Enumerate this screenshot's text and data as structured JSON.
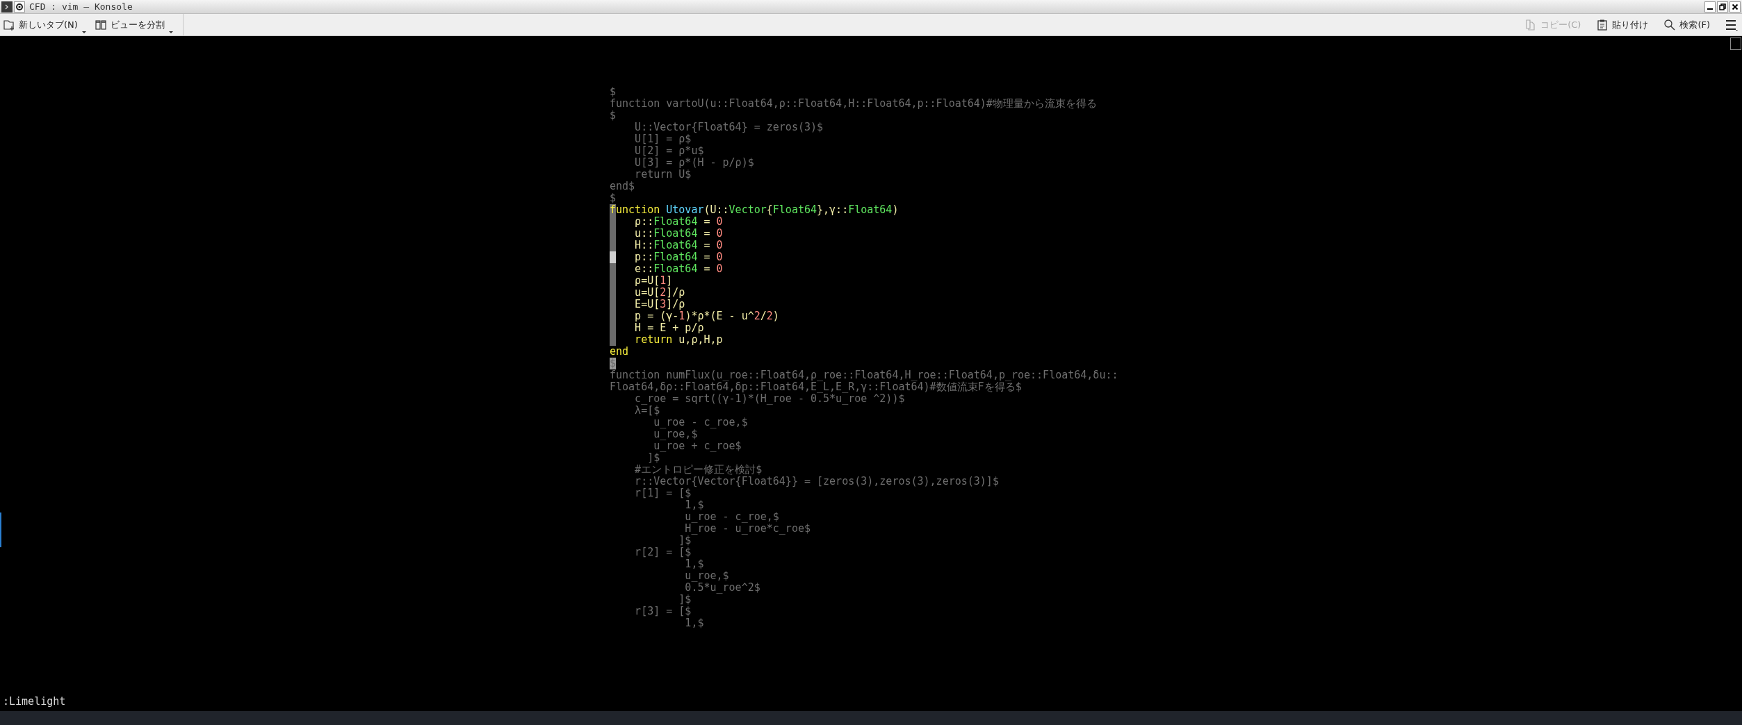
{
  "window": {
    "title": "CFD : vim — Konsole"
  },
  "toolbar": {
    "left": [
      {
        "label": "新しいタブ(N)",
        "dropdown": true
      },
      {
        "label": "ビューを分割",
        "dropdown": true
      }
    ],
    "right": [
      {
        "label": "コピー(C)",
        "disabled": true
      },
      {
        "label": "貼り付け",
        "disabled": false
      },
      {
        "label": "検索(F)",
        "disabled": false
      }
    ]
  },
  "editor": {
    "lines": [
      {
        "segments": [
          {
            "text": "$",
            "kind": "dim"
          }
        ]
      },
      {
        "segments": [
          {
            "text": "function vartoU(u::Float64,ρ::Float64,H::Float64,p::Float64)#物理量から流束を得る",
            "kind": "dim"
          }
        ]
      },
      {
        "segments": [
          {
            "text": "$",
            "kind": "dim"
          }
        ]
      },
      {
        "segments": [
          {
            "text": "    U::Vector{Float64} = zeros(3)$",
            "kind": "dim"
          }
        ]
      },
      {
        "segments": [
          {
            "text": "    U[1] = ρ$",
            "kind": "dim"
          }
        ]
      },
      {
        "segments": [
          {
            "text": "    U[2] = ρ*u$",
            "kind": "dim"
          }
        ]
      },
      {
        "segments": [
          {
            "text": "    U[3] = ρ*(H - p/ρ)$",
            "kind": "dim"
          }
        ]
      },
      {
        "segments": [
          {
            "text": "    return U$",
            "kind": "dim"
          }
        ]
      },
      {
        "segments": [
          {
            "text": "end$",
            "kind": "dim"
          }
        ]
      },
      {
        "segments": [
          {
            "text": "$",
            "kind": "dim"
          }
        ]
      },
      {
        "guide": true,
        "segments": [
          {
            "text": "function",
            "kind": "keyword"
          },
          {
            "text": " Utovar",
            "kind": "function"
          },
          {
            "text": "(U::",
            "kind": "text"
          },
          {
            "text": "Vector",
            "kind": "type"
          },
          {
            "text": "{",
            "kind": "text"
          },
          {
            "text": "Float64",
            "kind": "type"
          },
          {
            "text": "},γ::",
            "kind": "text"
          },
          {
            "text": "Float64",
            "kind": "type"
          },
          {
            "text": ")",
            "kind": "text"
          }
        ]
      },
      {
        "guide": true,
        "segments": [
          {
            "text": "    ρ::",
            "kind": "text"
          },
          {
            "text": "Float64",
            "kind": "type"
          },
          {
            "text": " = ",
            "kind": "text"
          },
          {
            "text": "0",
            "kind": "number"
          }
        ]
      },
      {
        "guide": true,
        "segments": [
          {
            "text": "    u::",
            "kind": "text"
          },
          {
            "text": "Float64",
            "kind": "type"
          },
          {
            "text": " = ",
            "kind": "text"
          },
          {
            "text": "0",
            "kind": "number"
          }
        ]
      },
      {
        "guide": true,
        "segments": [
          {
            "text": "    H::",
            "kind": "text"
          },
          {
            "text": "Float64",
            "kind": "type"
          },
          {
            "text": " = ",
            "kind": "text"
          },
          {
            "text": "0",
            "kind": "number"
          }
        ]
      },
      {
        "guide": true,
        "bright": true,
        "segments": [
          {
            "text": "    p::",
            "kind": "text"
          },
          {
            "text": "Float64",
            "kind": "type"
          },
          {
            "text": " = ",
            "kind": "text"
          },
          {
            "text": "0",
            "kind": "number"
          }
        ]
      },
      {
        "guide": true,
        "segments": [
          {
            "text": "    e::",
            "kind": "text"
          },
          {
            "text": "Float64",
            "kind": "type"
          },
          {
            "text": " = ",
            "kind": "text"
          },
          {
            "text": "0",
            "kind": "number"
          }
        ]
      },
      {
        "guide": true,
        "segments": [
          {
            "text": "    ρ=U[",
            "kind": "text"
          },
          {
            "text": "1",
            "kind": "number"
          },
          {
            "text": "]",
            "kind": "text"
          }
        ]
      },
      {
        "guide": true,
        "segments": [
          {
            "text": "    u=U[",
            "kind": "text"
          },
          {
            "text": "2",
            "kind": "number"
          },
          {
            "text": "]/ρ",
            "kind": "text"
          }
        ]
      },
      {
        "guide": true,
        "segments": [
          {
            "text": "    E=U[",
            "kind": "text"
          },
          {
            "text": "3",
            "kind": "number"
          },
          {
            "text": "]/ρ",
            "kind": "text"
          }
        ]
      },
      {
        "guide": true,
        "segments": [
          {
            "text": "    p = (γ-",
            "kind": "text"
          },
          {
            "text": "1",
            "kind": "number"
          },
          {
            "text": ")*ρ*(E - u^",
            "kind": "text"
          },
          {
            "text": "2",
            "kind": "number"
          },
          {
            "text": "/",
            "kind": "text"
          },
          {
            "text": "2",
            "kind": "number"
          },
          {
            "text": ")",
            "kind": "text"
          }
        ]
      },
      {
        "guide": true,
        "segments": [
          {
            "text": "    H = E + p/ρ",
            "kind": "text"
          }
        ]
      },
      {
        "guide": true,
        "segments": [
          {
            "text": "    return",
            "kind": "keyword"
          },
          {
            "text": " u,ρ,H,p",
            "kind": "text"
          }
        ]
      },
      {
        "segments": [
          {
            "text": "end",
            "kind": "keyword"
          }
        ]
      },
      {
        "cursor": true,
        "segments": [
          {
            "text": "$",
            "kind": "dim"
          }
        ]
      },
      {
        "segments": [
          {
            "text": "function numFlux(u_roe::Float64,ρ_roe::Float64,H_roe::Float64,p_roe::Float64,δu::",
            "kind": "dim"
          }
        ]
      },
      {
        "segments": [
          {
            "text": "Float64,δρ::Float64,δp::Float64,E_L,E_R,γ::Float64)#数値流束Fを得る$",
            "kind": "dim"
          }
        ]
      },
      {
        "segments": [
          {
            "text": "    c_roe = sqrt((γ-1)*(H_roe - 0.5*u_roe ^2))$",
            "kind": "dim"
          }
        ]
      },
      {
        "segments": [
          {
            "text": "    λ=[$",
            "kind": "dim"
          }
        ]
      },
      {
        "segments": [
          {
            "text": "       u_roe - c_roe,$",
            "kind": "dim"
          }
        ]
      },
      {
        "segments": [
          {
            "text": "       u_roe,$",
            "kind": "dim"
          }
        ]
      },
      {
        "segments": [
          {
            "text": "       u_roe + c_roe$",
            "kind": "dim"
          }
        ]
      },
      {
        "segments": [
          {
            "text": "      ]$",
            "kind": "dim"
          }
        ]
      },
      {
        "segments": [
          {
            "text": "    #エントロピー修正を検討$",
            "kind": "dim"
          }
        ]
      },
      {
        "segments": [
          {
            "text": "    r::Vector{Vector{Float64}} = [zeros(3),zeros(3),zeros(3)]$",
            "kind": "dim"
          }
        ]
      },
      {
        "segments": [
          {
            "text": "    r[1] = [$",
            "kind": "dim"
          }
        ]
      },
      {
        "segments": [
          {
            "text": "            1,$",
            "kind": "dim"
          }
        ]
      },
      {
        "segments": [
          {
            "text": "            u_roe - c_roe,$",
            "kind": "dim"
          }
        ]
      },
      {
        "segments": [
          {
            "text": "            H_roe - u_roe*c_roe$",
            "kind": "dim"
          }
        ]
      },
      {
        "segments": [
          {
            "text": "           ]$",
            "kind": "dim"
          }
        ]
      },
      {
        "segments": [
          {
            "text": "    r[2] = [$",
            "kind": "dim"
          }
        ]
      },
      {
        "segments": [
          {
            "text": "            1,$",
            "kind": "dim"
          }
        ]
      },
      {
        "segments": [
          {
            "text": "            u_roe,$",
            "kind": "dim"
          }
        ]
      },
      {
        "segments": [
          {
            "text": "            0.5*u_roe^2$",
            "kind": "dim"
          }
        ]
      },
      {
        "segments": [
          {
            "text": "           ]$",
            "kind": "dim"
          }
        ]
      },
      {
        "segments": [
          {
            "text": "    r[3] = [$",
            "kind": "dim"
          }
        ]
      },
      {
        "segments": [
          {
            "text": "            1,$",
            "kind": "dim"
          }
        ]
      }
    ]
  },
  "command_line": ":Limelight"
}
